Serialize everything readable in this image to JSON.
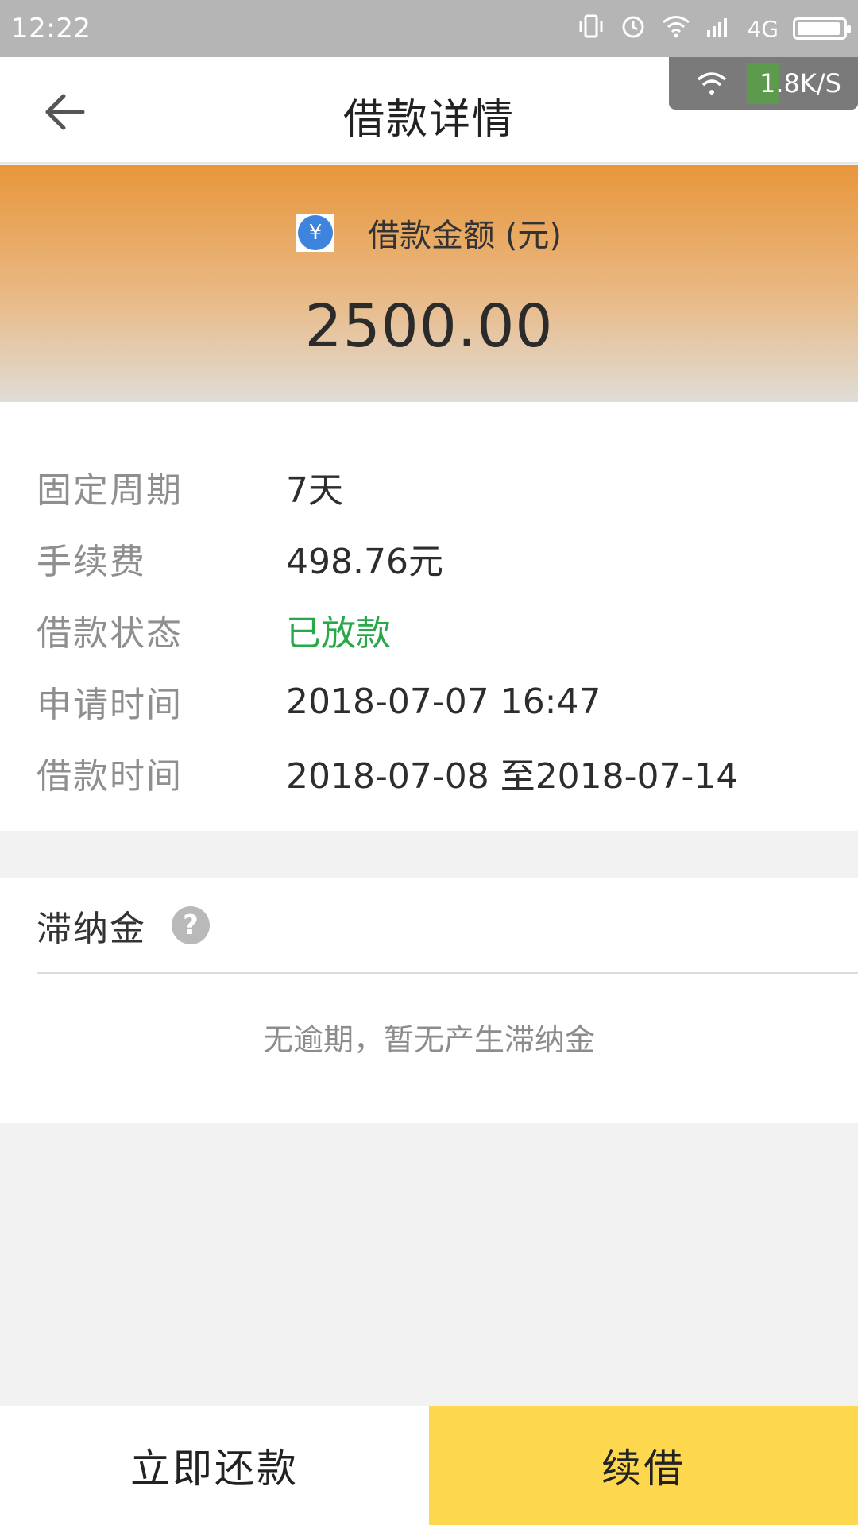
{
  "status_bar": {
    "time": "12:22",
    "network": "4G",
    "battery_level": 0.95,
    "icons": [
      "vibrate-icon",
      "alarm-icon",
      "wifi-icon",
      "signal-icon",
      "battery-icon"
    ]
  },
  "speed_overlay": {
    "speed": "1.8K/S",
    "icon": "wifi-icon"
  },
  "header": {
    "title": "借款详情",
    "back_icon": "arrow-left-icon"
  },
  "amount": {
    "label": "借款金额 (元)",
    "value": "2500.00",
    "icon_symbol": "¥"
  },
  "details": {
    "rows": [
      {
        "label": "固定周期",
        "value": "7天"
      },
      {
        "label": "手续费",
        "value": "498.76元"
      },
      {
        "label": "借款状态",
        "value": "已放款"
      },
      {
        "label": "申请时间",
        "value": "2018-07-07 16:47"
      },
      {
        "label": "借款时间",
        "value": "2018-07-08 至2018-07-14"
      }
    ]
  },
  "late_fee": {
    "title": "滞纳金",
    "help_symbol": "?",
    "empty_message": "无逾期，暂无产生滞纳金"
  },
  "actions": {
    "repay_label": "立即还款",
    "renew_label": "续借"
  },
  "colors": {
    "header_gradient_top": "#e8963a",
    "status_green": "#27a94a",
    "renew_button": "#fdd84e",
    "yen_blue": "#3f84dc"
  }
}
